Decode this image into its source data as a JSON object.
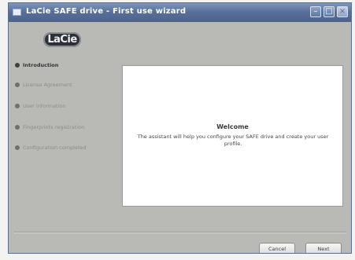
{
  "window": {
    "title": "LaCie SAFE drive - First use wizard",
    "controls": {
      "minimize_icon": "minimize-icon",
      "maximize_icon": "maximize-icon",
      "close_icon": "close-icon"
    }
  },
  "brand": {
    "logo_text": "LaCie"
  },
  "sidebar": {
    "steps": [
      {
        "label": "Introduction",
        "active": true
      },
      {
        "label": "License Agreement",
        "active": false
      },
      {
        "label": "User information",
        "active": false
      },
      {
        "label": "Fingerprints registration",
        "active": false
      },
      {
        "label": "Configuration completed",
        "active": false
      }
    ]
  },
  "main": {
    "welcome_title": "Welcome",
    "welcome_text": "The assistant will help you configure your SAFE drive and create your user profile."
  },
  "buttons": {
    "cancel_label": "Cancel",
    "next_label": "Next"
  },
  "colors": {
    "titlebar": "#58709b",
    "window_background": "#b9b9b6",
    "content_background": "#ffffff"
  }
}
